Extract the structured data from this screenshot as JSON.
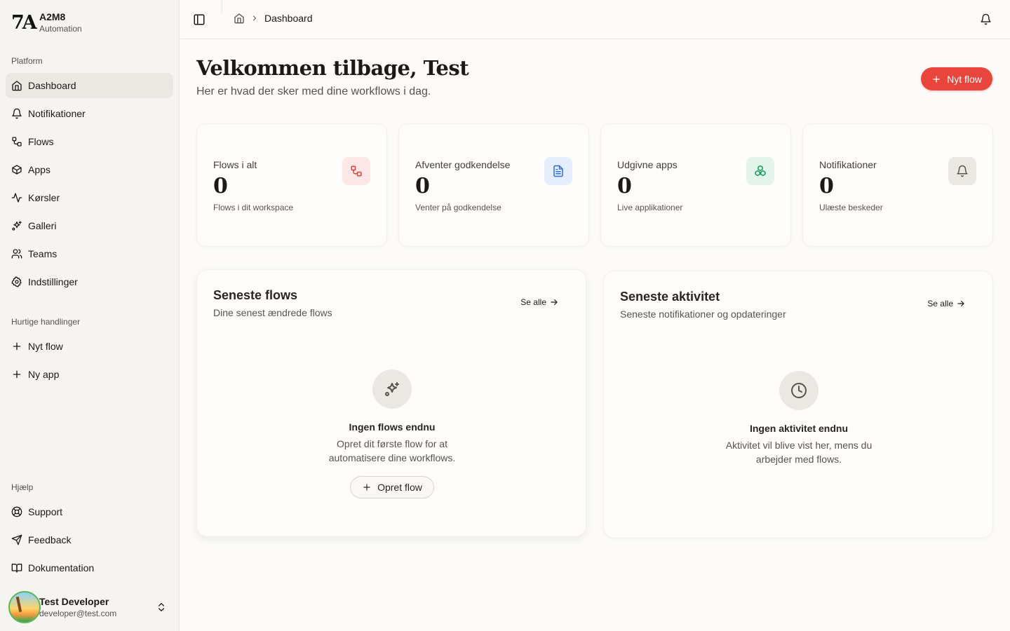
{
  "brand": {
    "name": "A2M8",
    "subtitle": "Automation"
  },
  "sidebar": {
    "platform_label": "Platform",
    "items": [
      {
        "label": "Dashboard",
        "icon": "home-icon"
      },
      {
        "label": "Notifikationer",
        "icon": "bell-icon"
      },
      {
        "label": "Flows",
        "icon": "flow-icon"
      },
      {
        "label": "Apps",
        "icon": "box-icon"
      },
      {
        "label": "Kørsler",
        "icon": "activity-icon"
      },
      {
        "label": "Galleri",
        "icon": "sparkles-icon"
      },
      {
        "label": "Teams",
        "icon": "users-icon"
      },
      {
        "label": "Indstillinger",
        "icon": "gear-icon"
      }
    ],
    "quick_label": "Hurtige handlinger",
    "quick_items": [
      {
        "label": "Nyt flow",
        "icon": "plus-icon"
      },
      {
        "label": "Ny app",
        "icon": "plus-icon"
      }
    ],
    "help_label": "Hjælp",
    "help_items": [
      {
        "label": "Support",
        "icon": "lifebuoy-icon"
      },
      {
        "label": "Feedback",
        "icon": "send-icon"
      },
      {
        "label": "Dokumentation",
        "icon": "book-icon"
      }
    ],
    "user": {
      "name": "Test Developer",
      "email": "developer@test.com"
    }
  },
  "header": {
    "breadcrumb": "Dashboard"
  },
  "main": {
    "title": "Velkommen tilbage, Test",
    "subtitle": "Her er hvad der sker med dine workflows i dag.",
    "new_flow_button": "Nyt flow",
    "stats": [
      {
        "label": "Flows i alt",
        "value": "0",
        "desc": "Flows i dit workspace",
        "icon": "flow-icon",
        "color": "#e0403a",
        "bg": "#fde8e7"
      },
      {
        "label": "Afventer godkendelse",
        "value": "0",
        "desc": "Venter på godkendelse",
        "icon": "document-icon",
        "color": "#2f6fdf",
        "bg": "#e5eefc"
      },
      {
        "label": "Udgivne apps",
        "value": "0",
        "desc": "Live applikationer",
        "icon": "boxes-icon",
        "color": "#1a9b5b",
        "bg": "#e3f5ea"
      },
      {
        "label": "Notifikationer",
        "value": "0",
        "desc": "Ulæste beskeder",
        "icon": "bell-icon",
        "color": "#57534e",
        "bg": "#ebe8e4"
      }
    ],
    "recent_flows": {
      "title": "Seneste flows",
      "subtitle": "Dine senest ændrede flows",
      "see_all": "Se alle",
      "empty_title": "Ingen flows endnu",
      "empty_text": "Opret dit første flow for at automatisere dine workflows.",
      "create_button": "Opret flow"
    },
    "recent_activity": {
      "title": "Seneste aktivitet",
      "subtitle": "Seneste notifikationer og opdateringer",
      "see_all": "Se alle",
      "empty_title": "Ingen aktivitet endnu",
      "empty_text": "Aktivitet vil blive vist her, mens du arbejder med flows."
    }
  }
}
